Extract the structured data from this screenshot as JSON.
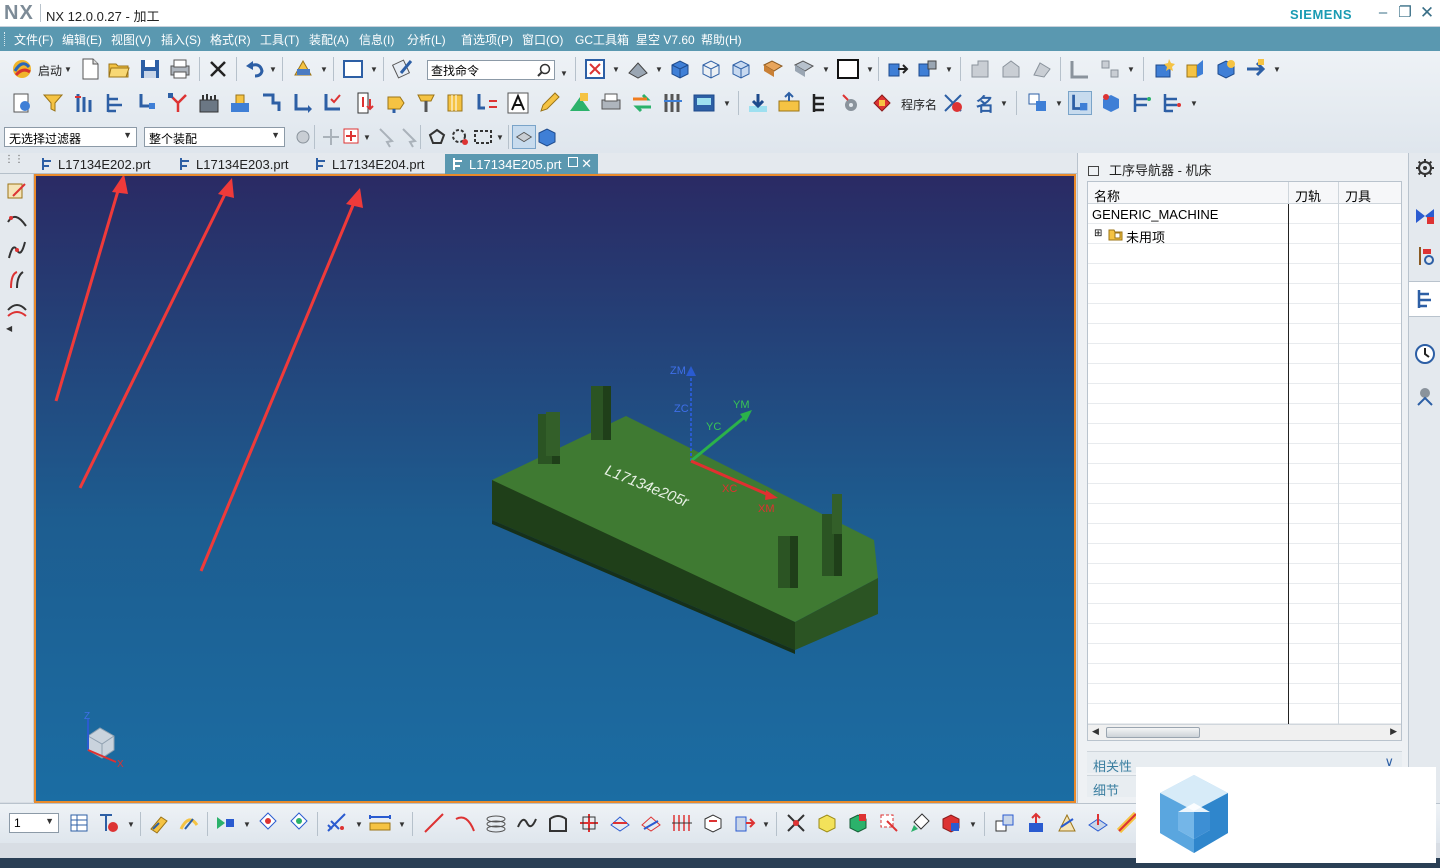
{
  "app": {
    "logo": "NX",
    "title": "NX 12.0.0.27 - 加工",
    "brand": "SIEMENS"
  },
  "window_controls": [
    "minimize-icon",
    "restore-icon",
    "close-icon"
  ],
  "menu": {
    "items": [
      "文件(F)",
      "编辑(E)",
      "视图(V)",
      "插入(S)",
      "格式(R)",
      "工具(T)",
      "装配(A)",
      "信息(I)",
      "分析(L)",
      "首选项(P)",
      "窗口(O)",
      "GC工具箱",
      "星空 V7.60",
      "帮助(H)"
    ]
  },
  "toolbar": {
    "start_label": "启动",
    "command_search_value": "查找命令",
    "program_name_label": "程序名",
    "name_label": "名",
    "selection_filter": "无选择过滤器",
    "assembly_scope": "整个装配"
  },
  "tabs": [
    {
      "label": "L17134E202.prt",
      "active": false
    },
    {
      "label": "L17134E203.prt",
      "active": false
    },
    {
      "label": "L17134E204.prt",
      "active": false
    },
    {
      "label": "L17134E205.prt",
      "active": true
    }
  ],
  "viewport": {
    "part_engraving": "L17134e205r",
    "axis_labels": {
      "zm": "ZM",
      "zc": "ZC",
      "ym": "YM",
      "yc": "YC",
      "xc": "XC",
      "xm": "XM"
    },
    "triad_labels": {
      "z": "Z",
      "x": "X"
    },
    "colors": {
      "part": "#3f7a32",
      "background_top": "#2a2a64",
      "background_bottom": "#1b6da3",
      "annotation_arrow": "#ef3a3a",
      "border": "#e98a2b"
    }
  },
  "navigator": {
    "title": "工序导航器 - 机床",
    "columns": [
      "名称",
      "刀轨",
      "刀具"
    ],
    "rows": [
      {
        "name": "GENERIC_MACHINE",
        "indent": 0
      },
      {
        "name": "未用项",
        "indent": 1
      }
    ],
    "sections": [
      "相关性",
      "细节"
    ]
  },
  "bottom_toolbar": {
    "layer_value": "1"
  }
}
